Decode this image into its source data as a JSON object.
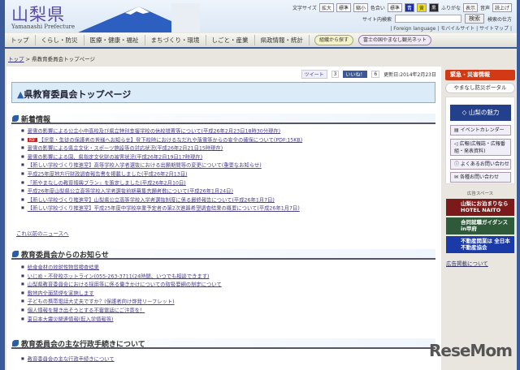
{
  "header": {
    "logo": "山梨県",
    "logo_sub": "Yamanashi Prefecture",
    "font_size_label": "文字サイズ",
    "font_sizes": [
      "拡大",
      "標準",
      "縮小"
    ],
    "color_label": "色合い",
    "colors": [
      "標準",
      "青",
      "黄",
      "黒"
    ],
    "furigana_label": "ふりがな",
    "furigana_btn": "表示",
    "voice_label": "音声",
    "voice_btn": "読上げ",
    "search_label": "サイト内検索",
    "search_value": "",
    "search_btn": "検索",
    "search_help": "検索の仕方",
    "links": [
      "Foreign language",
      "モバイルサイト",
      "サイトマップ"
    ]
  },
  "nav": {
    "items": [
      "トップ",
      "くらし・防災",
      "医療・健康・福祉",
      "まちづくり・環境",
      "しごと・産業",
      "県政情報・統計"
    ],
    "pills": [
      "組織から探す",
      "富士の国やまなし観光ネット"
    ]
  },
  "breadcrumb": {
    "home": "トップ",
    "sep": ">",
    "current": "県教育委員会トップページ"
  },
  "share": {
    "tweet": "ツイート",
    "tweet_count": "3",
    "like": "いいね！",
    "like_count": "6",
    "updated": "更新日:2014年2月23日"
  },
  "page_title": "県教育委員会トップページ",
  "sections": [
    {
      "title": "新着情報",
      "items": [
        "豪雪の影響による公立小中高校及び県立特別支援学校の休校措置等について(平成26年2月23日18時30分現在)",
        "【児童・生徒の保護者の皆様へお知らせ】登下校時におけるなだれや落雪等からの安全の確保について(PDF:15KB)",
        "豪雪の影響による県立文化・スポーツ施設等の対応状況(平成26年2月21日15時現在)",
        "豪雪の影響による国、県指定文化財の被害状況(平成26年2月19日17時現在)",
        "【新しい学校づくり推進室】高等学校入学者選抜における出願期間等の変更について(重要なお知らせ)",
        "平成25年度地方行財政調査報告書を掲載しました(平成26年2月13日)",
        "「新やまなしの教育振興プラン」を策定しました(平成26年2月10日)",
        "平成26年度山梨県公立高等学校入学者選抜前期募集志願者数について(平成26年1月24日)",
        "【新しい学校づくり推進室】山梨県公立高等学校入学者選抜制度に係る最終報告について(平成26年1月7日)",
        "【新しい学校づくり推進室】平成25年度中学校卒業予定者の第2次進路希望調査結果の概要について(平成26年1月7日)"
      ],
      "pdf_badge": "PDF",
      "more": "これ以前のニュースへ"
    },
    {
      "title": "教育委員会からのお知らせ",
      "items": [
        "給食食材の放射性物質検査結果",
        "いじめ・不登校ホットライン(055-263-3711(24時間、いつでも相談できます)",
        "山梨県教育委員会における採用等に係る働きかけについての取扱要綱の制定について",
        "敷地内全面禁煙を実施します",
        "子どもの携帯電話大丈夫ですか？(保護者向け啓発リーフレット)",
        "個人情報を聞き出そうとする不審電話にご注意を！",
        "東日本大震災関連情報(転入学情報等)"
      ]
    },
    {
      "title": "教育委員会の主な行政手続きについて",
      "items": [
        "教育委員会の主な行政手続きについて"
      ]
    }
  ],
  "sidebar": {
    "emergency": "緊急・災害情報",
    "portal": "やまなし防災ポータル",
    "miryoku": "山梨の魅力",
    "buttons": [
      "イベントカレンダー",
      "広報(広報誌・広報番組・発表資料)",
      "よくあるお問い合わせ",
      "各種お問い合わせ"
    ],
    "ad_label": "広告スペース",
    "ads": [
      {
        "text": "山梨にお泊まりなら HOTEL NAITO",
        "color": "#7a1a1a"
      },
      {
        "text": "合同就職ガイダンス in甲府",
        "color": "#2e5a3a"
      },
      {
        "text": "不動産開業は 全日本不動産協会",
        "color": "#1a3aa8"
      }
    ],
    "ad_link": "広告掲載について"
  },
  "watermark": "ReseMom"
}
